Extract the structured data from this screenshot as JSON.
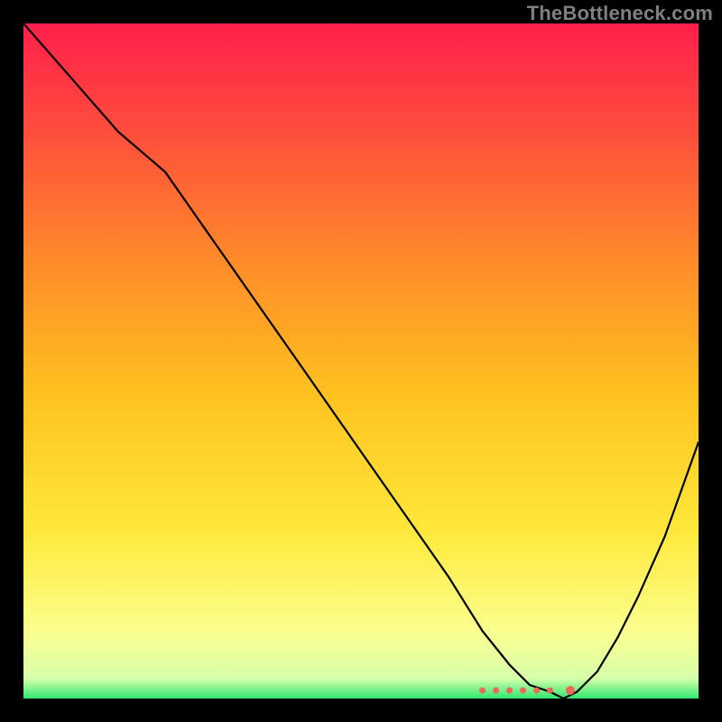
{
  "watermark": "TheBottleneck.com",
  "chart_data": {
    "type": "line",
    "title": "",
    "xlabel": "",
    "ylabel": "",
    "xlim": [
      0,
      100
    ],
    "ylim": [
      0,
      100
    ],
    "grid": false,
    "legend": false,
    "series": [
      {
        "name": "curve",
        "x": [
          0,
          7,
          14,
          21,
          28,
          35,
          42,
          49,
          56,
          63,
          68,
          72,
          75,
          78,
          80,
          82,
          85,
          88,
          91,
          95,
          100
        ],
        "values": [
          100,
          92,
          84,
          78,
          68,
          58,
          48,
          38,
          28,
          18,
          10,
          5,
          2,
          1,
          0,
          1,
          4,
          9,
          15,
          24,
          38
        ]
      }
    ],
    "markers": {
      "name": "annotation-points",
      "x": [
        68,
        70,
        72,
        74,
        76,
        78,
        81
      ],
      "values": [
        1.2,
        1.2,
        1.2,
        1.2,
        1.2,
        1.2,
        1.2
      ]
    },
    "gradient_stops": [
      {
        "offset": 0.0,
        "color": "#ff1f4b"
      },
      {
        "offset": 0.15,
        "color": "#ff4a3e"
      },
      {
        "offset": 0.35,
        "color": "#ff8a2a"
      },
      {
        "offset": 0.55,
        "color": "#ffc21f"
      },
      {
        "offset": 0.75,
        "color": "#ffe83a"
      },
      {
        "offset": 0.9,
        "color": "#fbff8e"
      },
      {
        "offset": 0.97,
        "color": "#d8ffab"
      },
      {
        "offset": 1.0,
        "color": "#2ee86f"
      }
    ],
    "curve_color": "#000000",
    "marker_color": "#e96a5a"
  }
}
